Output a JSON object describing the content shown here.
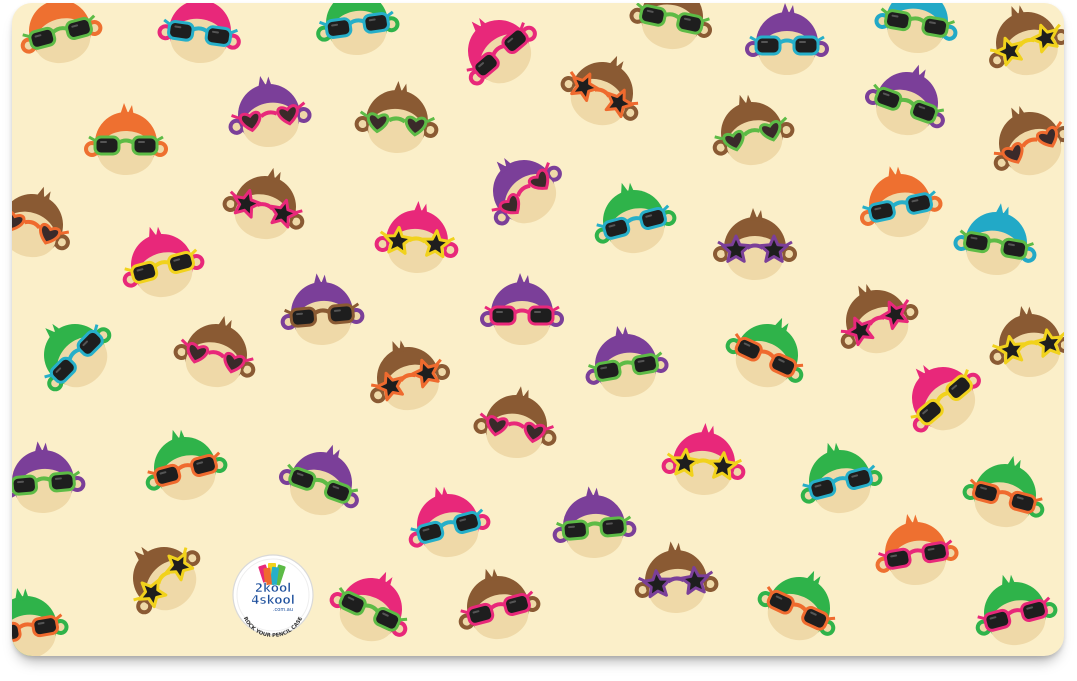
{
  "logo": {
    "line1": "2kool",
    "line2": "4skool",
    "domain": ".com.au",
    "tagline": "ROCK YOUR PENCIL CASE"
  },
  "colors": {
    "background": "#fbefc9",
    "skin": "#efd9a8",
    "hair": [
      "#ee7030",
      "#e8287a",
      "#2fb34a",
      "#7b3f99",
      "#8a5a33",
      "#22a9c7"
    ],
    "frames": [
      "#ef6a2e",
      "#e8287a",
      "#5dbb46",
      "#26afc9",
      "#f1d21c",
      "#8a5a33",
      "#7b3f99"
    ]
  },
  "monkeys": [
    {
      "hair": 0,
      "frame": 2,
      "glasses": "round"
    },
    {
      "hair": 1,
      "frame": 3,
      "glasses": "round"
    },
    {
      "hair": 2,
      "frame": 3,
      "glasses": "round"
    },
    {
      "hair": 1,
      "frame": 1,
      "glasses": "round"
    },
    {
      "hair": 4,
      "frame": 2,
      "glasses": "round"
    },
    {
      "hair": 3,
      "frame": 3,
      "glasses": "round"
    },
    {
      "hair": 5,
      "frame": 2,
      "glasses": "round"
    },
    {
      "hair": 4,
      "frame": 4,
      "glasses": "star"
    },
    {
      "hair": 0,
      "frame": 2,
      "glasses": "round"
    },
    {
      "hair": 3,
      "frame": 1,
      "glasses": "heart"
    },
    {
      "hair": 4,
      "frame": 2,
      "glasses": "heart"
    },
    {
      "hair": 4,
      "frame": 0,
      "glasses": "star"
    },
    {
      "hair": 4,
      "frame": 2,
      "glasses": "heart"
    },
    {
      "hair": 3,
      "frame": 2,
      "glasses": "round"
    },
    {
      "hair": 4,
      "frame": 0,
      "glasses": "heart"
    },
    {
      "hair": 4,
      "frame": 0,
      "glasses": "heart"
    },
    {
      "hair": 4,
      "frame": 1,
      "glasses": "star"
    },
    {
      "hair": 1,
      "frame": 4,
      "glasses": "round"
    },
    {
      "hair": 3,
      "frame": 1,
      "glasses": "heart"
    },
    {
      "hair": 2,
      "frame": 3,
      "glasses": "round"
    },
    {
      "hair": 1,
      "frame": 4,
      "glasses": "star"
    },
    {
      "hair": 4,
      "frame": 6,
      "glasses": "star"
    },
    {
      "hair": 0,
      "frame": 3,
      "glasses": "round"
    },
    {
      "hair": 5,
      "frame": 2,
      "glasses": "round"
    },
    {
      "hair": 2,
      "frame": 3,
      "glasses": "round"
    },
    {
      "hair": 3,
      "frame": 5,
      "glasses": "round"
    },
    {
      "hair": 3,
      "frame": 1,
      "glasses": "round"
    },
    {
      "hair": 3,
      "frame": 2,
      "glasses": "round"
    },
    {
      "hair": 4,
      "frame": 1,
      "glasses": "heart"
    },
    {
      "hair": 4,
      "frame": 0,
      "glasses": "star"
    },
    {
      "hair": 2,
      "frame": 0,
      "glasses": "round"
    },
    {
      "hair": 4,
      "frame": 1,
      "glasses": "star"
    },
    {
      "hair": 4,
      "frame": 4,
      "glasses": "star"
    },
    {
      "hair": 1,
      "frame": 4,
      "glasses": "round"
    },
    {
      "hair": 4,
      "frame": 1,
      "glasses": "heart"
    },
    {
      "hair": 3,
      "frame": 2,
      "glasses": "round"
    },
    {
      "hair": 2,
      "frame": 0,
      "glasses": "round"
    },
    {
      "hair": 3,
      "frame": 2,
      "glasses": "round"
    },
    {
      "hair": 1,
      "frame": 4,
      "glasses": "star"
    },
    {
      "hair": 2,
      "frame": 3,
      "glasses": "round"
    },
    {
      "hair": 2,
      "frame": 0,
      "glasses": "round"
    },
    {
      "hair": 1,
      "frame": 3,
      "glasses": "round"
    },
    {
      "hair": 3,
      "frame": 2,
      "glasses": "round"
    },
    {
      "hair": 0,
      "frame": 1,
      "glasses": "round"
    },
    {
      "hair": 4,
      "frame": 6,
      "glasses": "star"
    },
    {
      "hair": 4,
      "frame": 4,
      "glasses": "star"
    },
    {
      "hair": 1,
      "frame": 2,
      "glasses": "round"
    },
    {
      "hair": 4,
      "frame": 1,
      "glasses": "round"
    },
    {
      "hair": 2,
      "frame": 0,
      "glasses": "round"
    },
    {
      "hair": 2,
      "frame": 0,
      "glasses": "round"
    },
    {
      "hair": 2,
      "frame": 1,
      "glasses": "round"
    }
  ]
}
